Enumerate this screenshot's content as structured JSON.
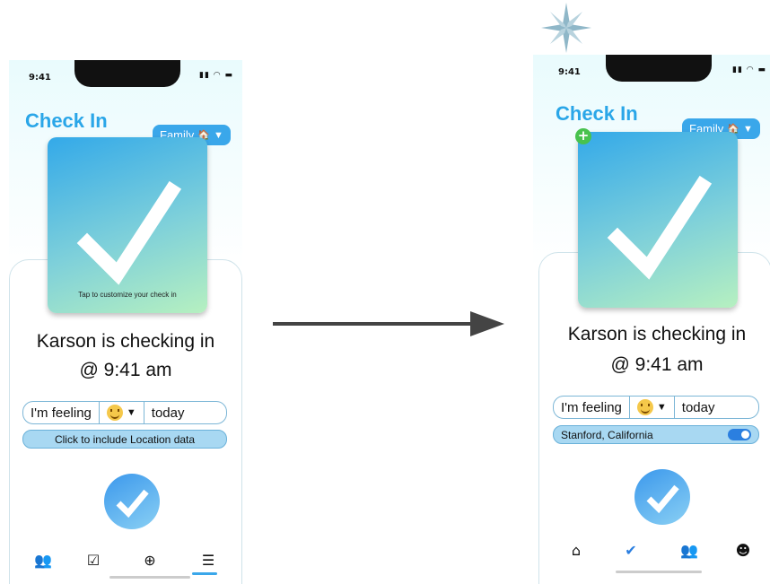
{
  "before": {
    "status_time": "9:41",
    "title": "Check In",
    "group_selector": "Family",
    "card_caption": "Tap to customize your check in",
    "checkin_name_line": "Karson is checking in",
    "checkin_time_line": "@ 9:41 am",
    "feeling_prefix": "I'm feeling",
    "feeling_suffix": "today",
    "location_button": "Click to include Location data",
    "tabs": [
      "people-icon",
      "check-icon",
      "basketball-icon",
      "scrapbook-icon"
    ]
  },
  "after": {
    "status_time": "9:41",
    "title": "Check In",
    "group_selector": "Family",
    "checkin_name_line": "Karson is checking in",
    "checkin_time_line": "@ 9:41 am",
    "feeling_prefix": "I'm feeling",
    "feeling_suffix": "today",
    "location_value": "Stanford, California",
    "location_toggle_on": true,
    "tabs": [
      "home-icon",
      "check-circle-icon",
      "people-icon",
      "profile-icon"
    ]
  },
  "colors": {
    "accent": "#2aa6e8",
    "group_button": "#3aa7ea",
    "plus_badge": "#48c24e",
    "toggle_on": "#2b7fe0"
  }
}
